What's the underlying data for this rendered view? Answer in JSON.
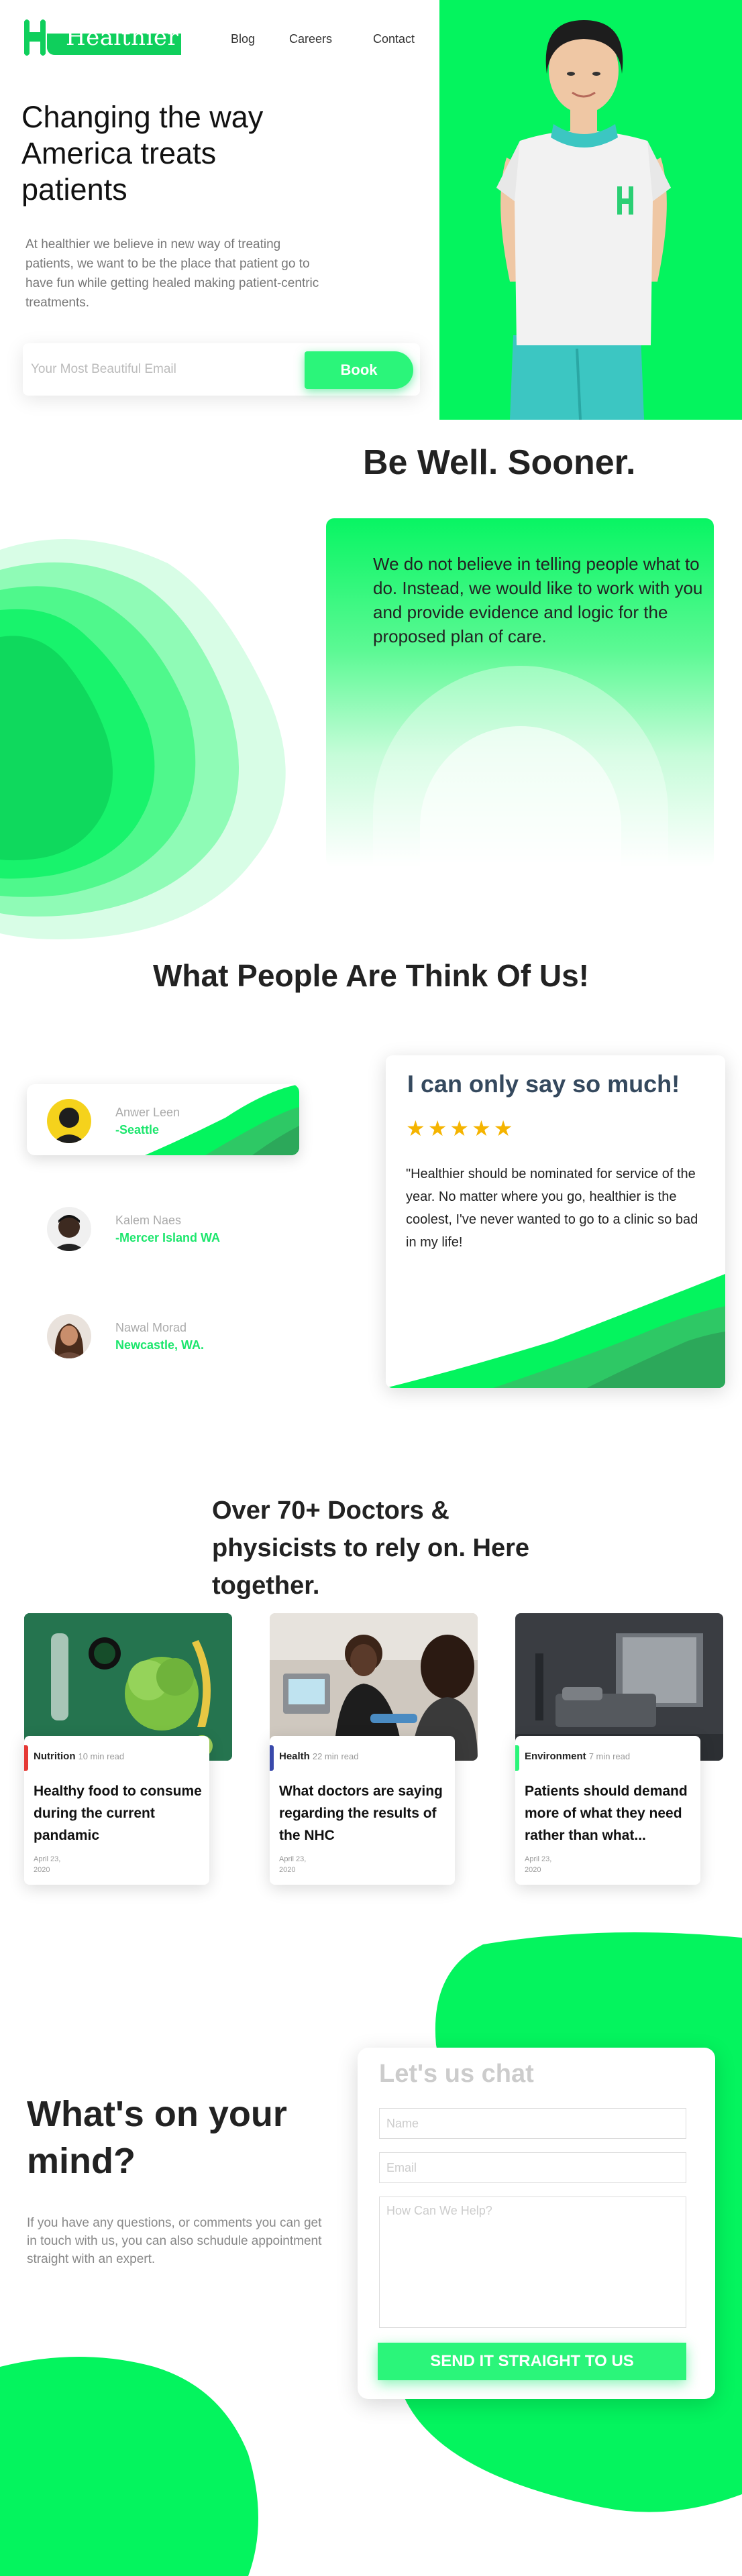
{
  "brand": {
    "name": "Healthier",
    "color": "#04f45e",
    "dark_green": "#0fcf5c"
  },
  "nav": {
    "blog": "Blog",
    "careers": "Careers",
    "contact": "Contact"
  },
  "hero": {
    "title": "Changing the way America treats patients",
    "description": "At healthier we believe in new way of treating patients, we want to be the place that patient go to have fun while getting healed making patient-centric treatments.",
    "email_placeholder": "Your Most Beautiful Email",
    "book_label": "Book",
    "photo_icon": "doctor-photo"
  },
  "philosophy": {
    "heading": "Be Well. Sooner.",
    "text": "We do not believe in telling people what to do. Instead, we would like to work with you and provide evidence and logic for the proposed plan of care."
  },
  "testimonials": {
    "heading": "What People Are Think Of Us!",
    "people": [
      {
        "name": "Anwer Leen",
        "location": "-Seattle"
      },
      {
        "name": "Kalem Naes",
        "location": "-Mercer Island WA"
      },
      {
        "name": "Nawal Morad",
        "location": "Newcastle, WA."
      }
    ],
    "review": {
      "title": "I can only say so much!",
      "stars": "★★★★★",
      "rating": 5,
      "text": "\"Healthier should be nominated for service of the year. No matter where you go, healthier is the coolest, I've never wanted to go to a clinic so bad in my life!"
    }
  },
  "doctors": {
    "heading": "Over 70+ Doctors & physicists to rely on. Here together.",
    "articles": [
      {
        "category": "Nutrition",
        "time": "10 min read",
        "title": "Healthy food to consume during the current pandamic",
        "date": "April 23, 2020",
        "bar_color": "#e53935"
      },
      {
        "category": "Health",
        "time": "22 min read",
        "title": "What doctors are saying regarding the results of the NHC",
        "date": "April 23, 2020",
        "bar_color": "#3949ab"
      },
      {
        "category": "Environment",
        "time": "7 min read",
        "title": "Patients should demand more of what they need rather than what...",
        "date": "April 23, 2020",
        "bar_color": "#2bf57a"
      }
    ]
  },
  "contact": {
    "heading": "What's on your mind?",
    "description": "If you have any questions, or comments you can get in touch with us, you can also schudule appointment straight with an expert.",
    "form_title": "Let's us chat",
    "name_placeholder": "Name",
    "email_placeholder": "Email",
    "message_placeholder": "How Can We Help?",
    "send_label": "SEND IT STRAIGHT TO US"
  }
}
